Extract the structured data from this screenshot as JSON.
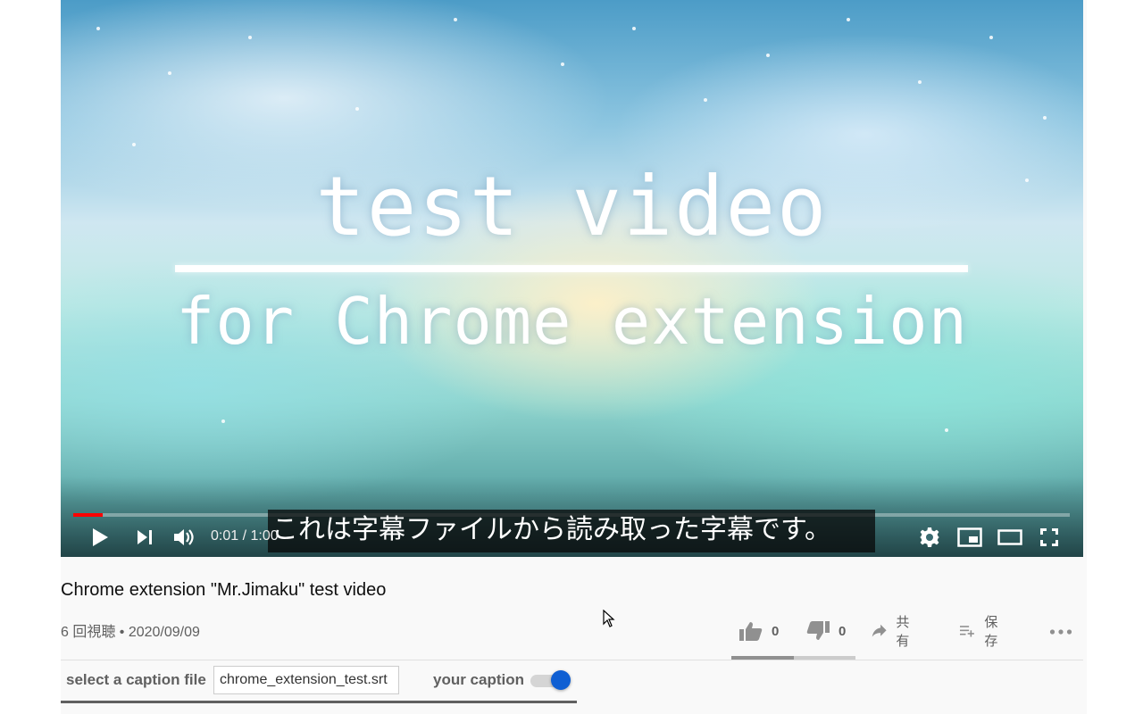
{
  "player": {
    "video_title_line1": "test video",
    "video_title_line2": "for Chrome extension",
    "caption_text": "これは字幕ファイルから読み取った字幕です。",
    "time_display": "0:01 / 1:00",
    "progress_fraction": 0.03,
    "progress_color": "#ff0000",
    "controls": {
      "play_icon": "play-icon",
      "next_icon": "skip-next-icon",
      "volume_icon": "volume-icon",
      "settings_icon": "gear-icon",
      "miniplayer_icon": "miniplayer-icon",
      "theater_icon": "theater-mode-icon",
      "fullscreen_icon": "fullscreen-icon"
    }
  },
  "video": {
    "title": "Chrome extension \"Mr.Jimaku\" test video",
    "meta": "6 回視聴 • 2020/09/09"
  },
  "actions": {
    "like_count": "0",
    "dislike_count": "0",
    "share_label": "共有",
    "save_label": "保存",
    "like_fraction": 0.5
  },
  "extension": {
    "select_label": "select a caption file",
    "file_name": "chrome_extension_test.srt",
    "toggle_label": "your caption",
    "toggle_on": true,
    "toggle_color": "#0f5fd3"
  }
}
